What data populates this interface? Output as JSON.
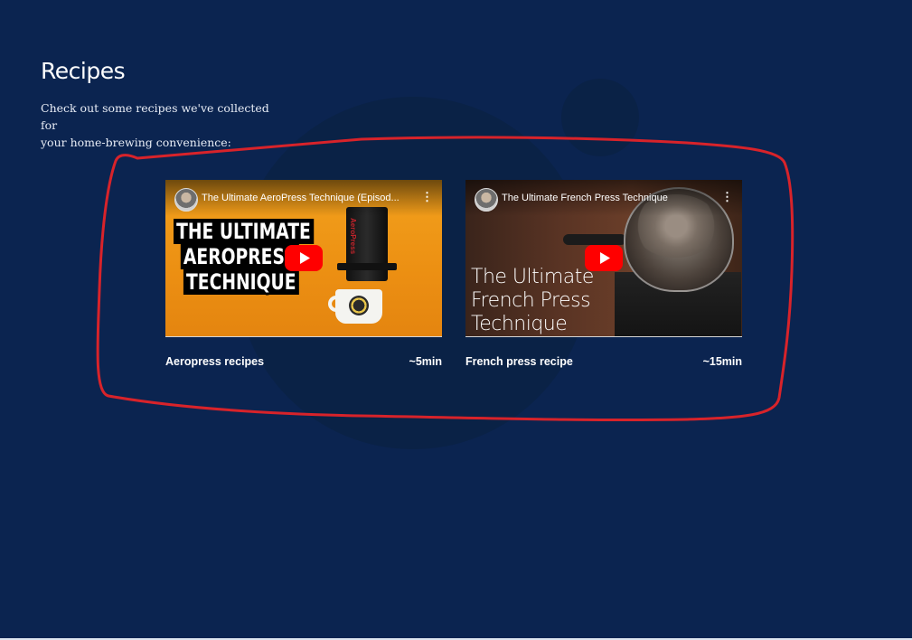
{
  "page": {
    "title": "Recipes",
    "intro_line1": "Check out some recipes we've collected for",
    "intro_line2": "your home-brewing convenience:"
  },
  "colors": {
    "background": "#0b2450",
    "annotation": "#d8232a",
    "play_button": "#ff0000"
  },
  "recipes": [
    {
      "name": "Aeropress recipes",
      "duration": "~5min",
      "video": {
        "title": "The Ultimate AeroPress Technique (Episod...",
        "thumbnail_lines": [
          "THE ULTIMATE",
          "AEROPRESS",
          "TECHNIQUE"
        ],
        "device_stamp": "AeroPress",
        "icons": [
          "channel-avatar-icon",
          "kebab-menu-icon",
          "youtube-play-icon"
        ]
      }
    },
    {
      "name": "French press recipe",
      "duration": "~15min",
      "video": {
        "title": "The Ultimate French Press Technique",
        "thumbnail_lines": [
          "The Ultimate",
          "French Press",
          "Technique"
        ],
        "icons": [
          "channel-avatar-icon",
          "kebab-menu-icon",
          "youtube-play-icon"
        ]
      }
    }
  ],
  "kebab_glyph": "⋮"
}
